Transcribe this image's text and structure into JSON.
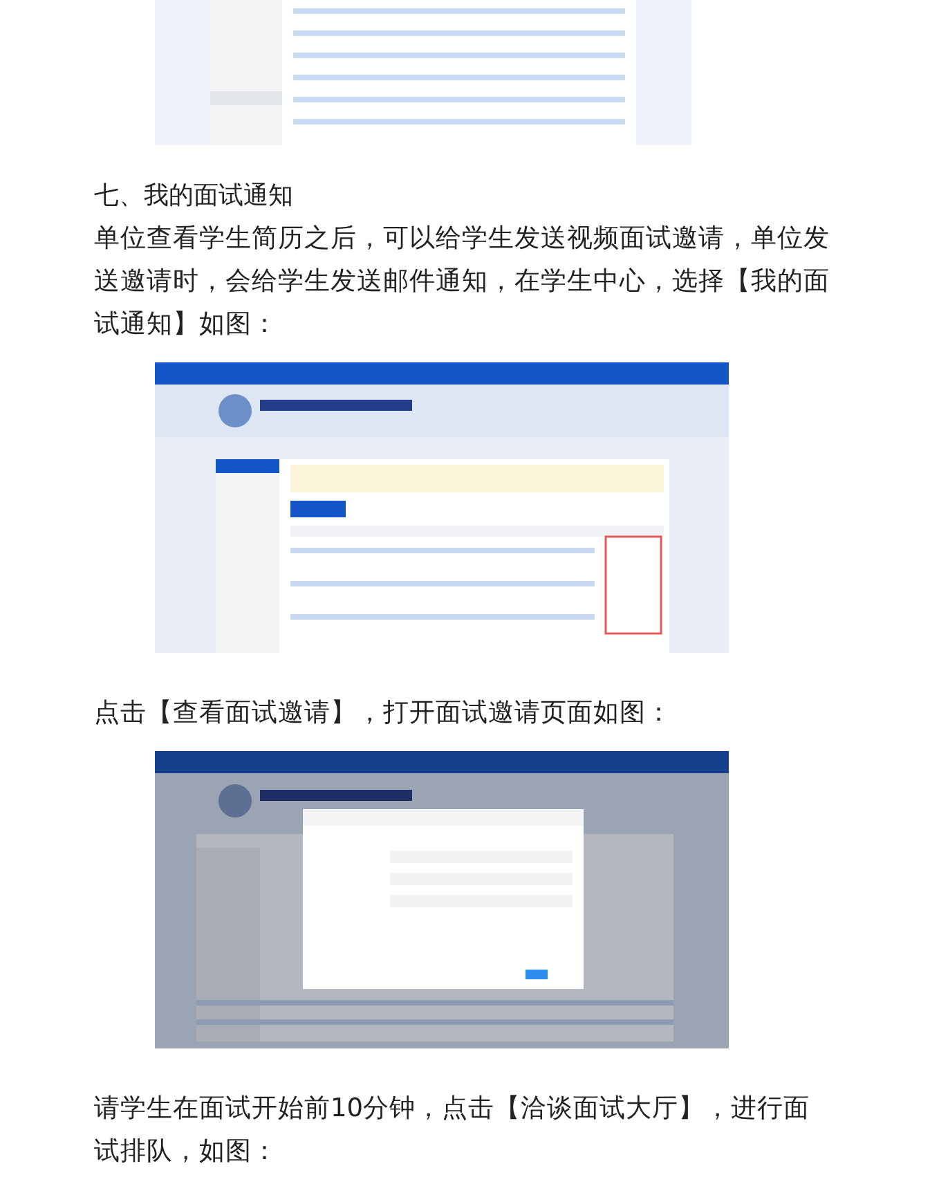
{
  "blocks": [
    {
      "kind": "picture"
    },
    {
      "kind": "heading",
      "text": "七、我的面试通知"
    },
    {
      "kind": "paragraph",
      "text": "单位查看学生简历之后，可以给学生发送视频面试邀请，单位发送邀请时，会给学生发送邮件通知，在学生中心，选择【我的面试通知】如图："
    },
    {
      "kind": "picture"
    },
    {
      "kind": "paragraph",
      "text": "点击【查看面试邀请】，打开面试邀请页面如图："
    },
    {
      "kind": "picture"
    },
    {
      "kind": "paragraph",
      "text": "请学生在面试开始前10分钟，点击【洽谈面试大厅】，进行面试排队，如图："
    }
  ]
}
